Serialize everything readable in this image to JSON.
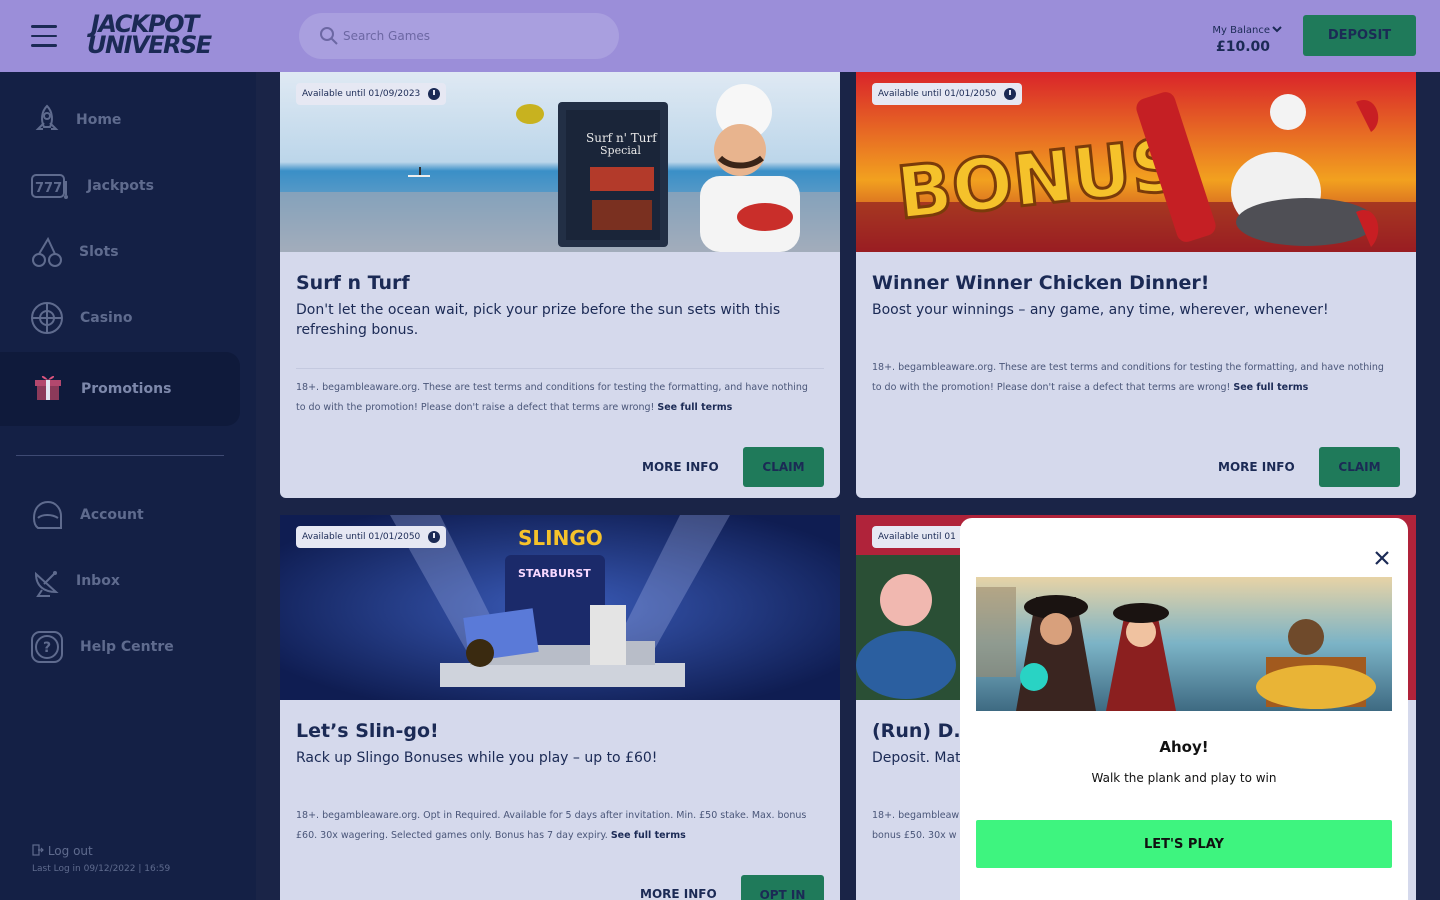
{
  "header": {
    "logo_line1": "JACKPOT",
    "logo_line2": "UNIVERSE",
    "search_placeholder": "Search Games",
    "balance_label": "My Balance",
    "balance_value": "£10.00",
    "deposit_label": "DEPOSIT"
  },
  "sidebar": {
    "items": [
      {
        "label": "Home",
        "icon": "rocket-icon"
      },
      {
        "label": "Jackpots",
        "icon": "slot-777-icon"
      },
      {
        "label": "Slots",
        "icon": "cherry-icon"
      },
      {
        "label": "Casino",
        "icon": "roulette-icon"
      },
      {
        "label": "Promotions",
        "icon": "gift-icon",
        "active": true
      },
      {
        "label": "Account",
        "icon": "helmet-icon"
      },
      {
        "label": "Inbox",
        "icon": "satellite-icon"
      },
      {
        "label": "Help Centre",
        "icon": "help-icon"
      }
    ],
    "logout_label": "Log out",
    "last_login": "Last Log in 09/12/2022 | 16:59"
  },
  "promotions": [
    {
      "available": "Available until 01/09/2023",
      "title": "Surf n Turf",
      "description": "Don't let the ocean wait,  pick your prize before the sun sets with this refreshing bonus.",
      "terms": "18+. begambleaware.org. These are test terms and conditions for testing the formatting, and have nothing to do with the promotion! Please don't raise a defect that terms are wrong!",
      "terms_link": "See full terms",
      "more_info": "MORE INFO",
      "action": "CLAIM",
      "image_text": [
        "Surf n' Turf",
        "Special"
      ]
    },
    {
      "available": "Available until 01/01/2050",
      "title": "Winner Winner Chicken Dinner!",
      "description": "Boost your winnings – any game, any time, wherever, whenever!",
      "terms": "18+. begambleaware.org. These are test terms and conditions for testing the formatting, and have nothing to do with the promotion! Please don't raise a defect that terms are wrong!",
      "terms_link": "See full terms",
      "more_info": "MORE INFO",
      "action": "CLAIM",
      "image_text": "BONUS"
    },
    {
      "available": "Available until 01/01/2050",
      "title": "Let’s Slin-go!",
      "description": "Rack up Slingo Bonuses while you play – up to £60!",
      "terms": "18+. begambleaware.org. Opt in Required. Available for 5 days after invitation. Min. £50 stake. Max. bonus £60. 30x wagering. Selected games only. Bonus has 7 day expiry.",
      "terms_link": "See full terms",
      "more_info": "MORE INFO",
      "action": "OPT IN",
      "image_text": [
        "SLINGO",
        "STARBURST"
      ]
    },
    {
      "available": "Available until 01",
      "title": "(Run) D.M",
      "description": "Deposit. Mat",
      "terms_line1": "18+. begambleaw",
      "terms_line2": "bonus £50. 30x w"
    }
  ],
  "modal": {
    "title": "Ahoy!",
    "subtitle": "Walk the plank and play to win",
    "button": "LET'S PLAY"
  },
  "colors": {
    "header": "#9b8ed9",
    "sidebar": "#142045",
    "accent_green": "#1f7a5a",
    "play_green": "#3ef47f",
    "card": "#d5d9ec"
  }
}
